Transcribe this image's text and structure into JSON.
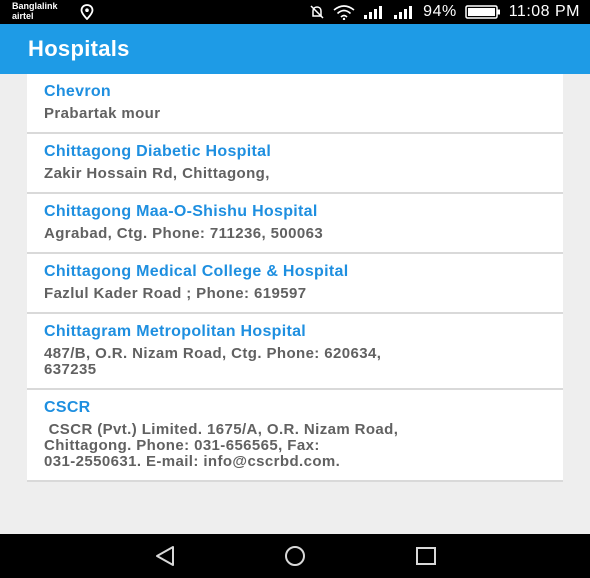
{
  "status_bar": {
    "carrier_line1": "Banglalink",
    "carrier_line2": "airtel",
    "battery": "94%",
    "time": "11:08 PM"
  },
  "app_bar": {
    "title": "Hospitals"
  },
  "hospitals": [
    {
      "name": "Chevron",
      "detail": "Prabartak mour"
    },
    {
      "name": "Chittagong Diabetic Hospital",
      "detail": "Zakir Hossain Rd, Chittagong,"
    },
    {
      "name": "Chittagong Maa-O-Shishu Hospital",
      "detail": "Agrabad, Ctg. Phone: 711236, 500063"
    },
    {
      "name": "Chittagong Medical College & Hospital",
      "detail": "Fazlul Kader Road ; Phone: 619597"
    },
    {
      "name": "Chittagram Metropolitan Hospital",
      "detail": "487/B, O.R. Nizam Road, Ctg. Phone: 620634,\n637235"
    },
    {
      "name": "CSCR",
      "detail": " CSCR (Pvt.) Limited. 1675/A, O.R. Nizam Road,\nChittagong. Phone: 031-656565, Fax:\n031-2550631. E-mail: info@cscrbd.com."
    }
  ],
  "colors": {
    "app_bar": "#1e9be6",
    "hospital_name": "#1e8fe0",
    "detail_text": "#616161",
    "list_background": "#eeeeee"
  },
  "icons": {
    "status": [
      "location-icon",
      "mute-icon",
      "wifi-icon",
      "signal-icon",
      "battery-icon"
    ],
    "navigation": [
      "back-icon",
      "home-icon",
      "recents-icon"
    ]
  }
}
